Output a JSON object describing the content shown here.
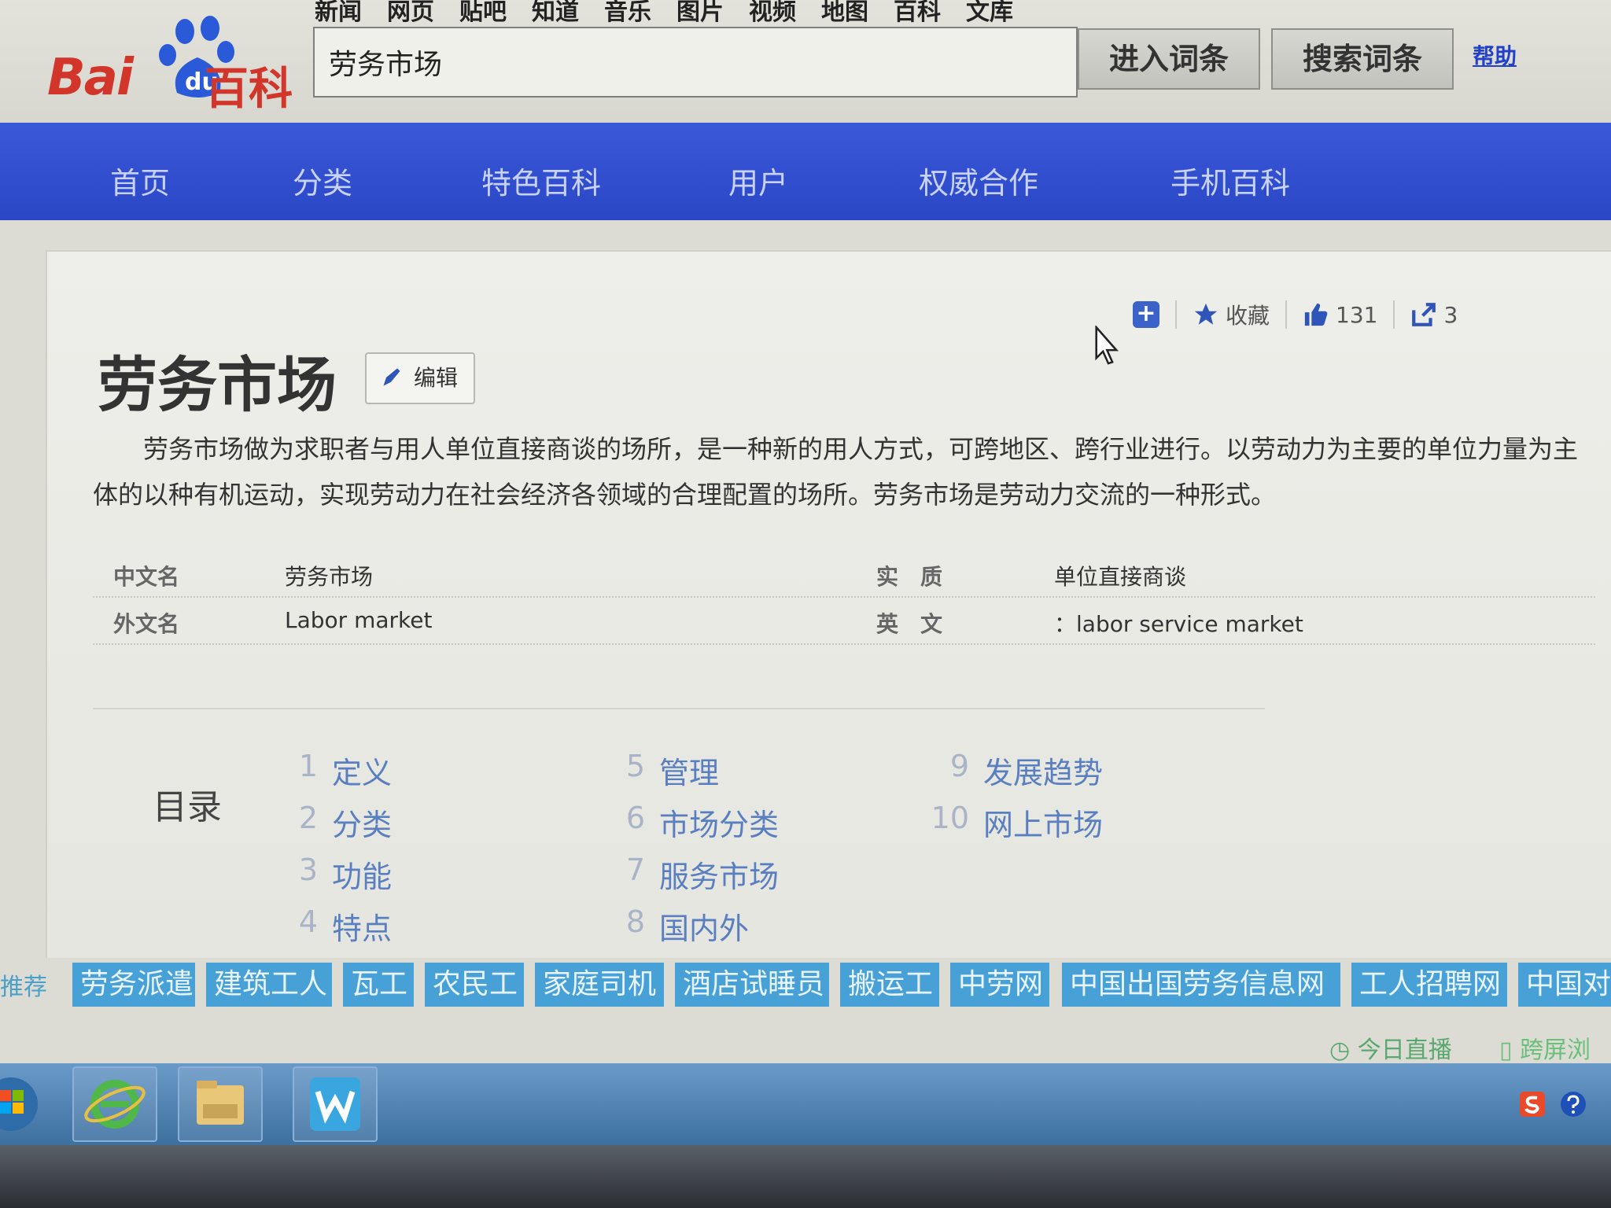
{
  "topnav": [
    "新闻",
    "网页",
    "贴吧",
    "知道",
    "音乐",
    "图片",
    "视频",
    "地图",
    "百科",
    "文库"
  ],
  "logo": {
    "bai": "Bai",
    "du": "du",
    "baike": "百科"
  },
  "search": {
    "value": "劳务市场",
    "enter_label": "进入词条",
    "search_label": "搜索词条",
    "help_label": "帮助"
  },
  "nav": [
    "首页",
    "分类",
    "特色百科",
    "用户",
    "权威合作",
    "手机百科"
  ],
  "actions": {
    "favorite_label": "收藏",
    "like_count": "131",
    "share_count": "3"
  },
  "entry": {
    "title": "劳务市场",
    "edit_label": "编辑",
    "summary": "劳务市场做为求职者与用人单位直接商谈的场所，是一种新的用人方式，可跨地区、跨行业进行。以劳动力为主要的单位力量为主体的以种有机运动，实现劳动力在社会经济各领域的合理配置的场所。劳务市场是劳动力交流的一种形式。"
  },
  "basic_info": [
    {
      "label": "中文名",
      "value": "劳务市场",
      "label2": "实　质",
      "value2": "单位直接商谈"
    },
    {
      "label": "外文名",
      "value": "Labor market",
      "label2": "英　文",
      "value2": "：labor service market"
    }
  ],
  "toc": {
    "title": "目录",
    "items": [
      {
        "num": "1",
        "text": "定义"
      },
      {
        "num": "2",
        "text": "分类"
      },
      {
        "num": "3",
        "text": "功能"
      },
      {
        "num": "4",
        "text": "特点"
      },
      {
        "num": "5",
        "text": "管理"
      },
      {
        "num": "6",
        "text": "市场分类"
      },
      {
        "num": "7",
        "text": "服务市场"
      },
      {
        "num": "8",
        "text": "国内外"
      },
      {
        "num": "9",
        "text": "发展趋势"
      },
      {
        "num": "10",
        "text": "网上市场"
      }
    ]
  },
  "recommend": {
    "label": "推荐",
    "tags": [
      "劳务派遣",
      "建筑工人",
      "瓦工",
      "农民工",
      "家庭司机",
      "酒店试睡员",
      "搬运工",
      "中劳网",
      "中国出国劳务信息网",
      "工人招聘网",
      "中国对"
    ]
  },
  "sub_links": {
    "live": "今日直播",
    "cross": "跨屏浏览"
  },
  "colors": {
    "brand_red": "#d2362b",
    "nav_blue": "#2a47c6",
    "link_blue": "#5a7fc0",
    "tag_blue": "#47a0d6"
  }
}
